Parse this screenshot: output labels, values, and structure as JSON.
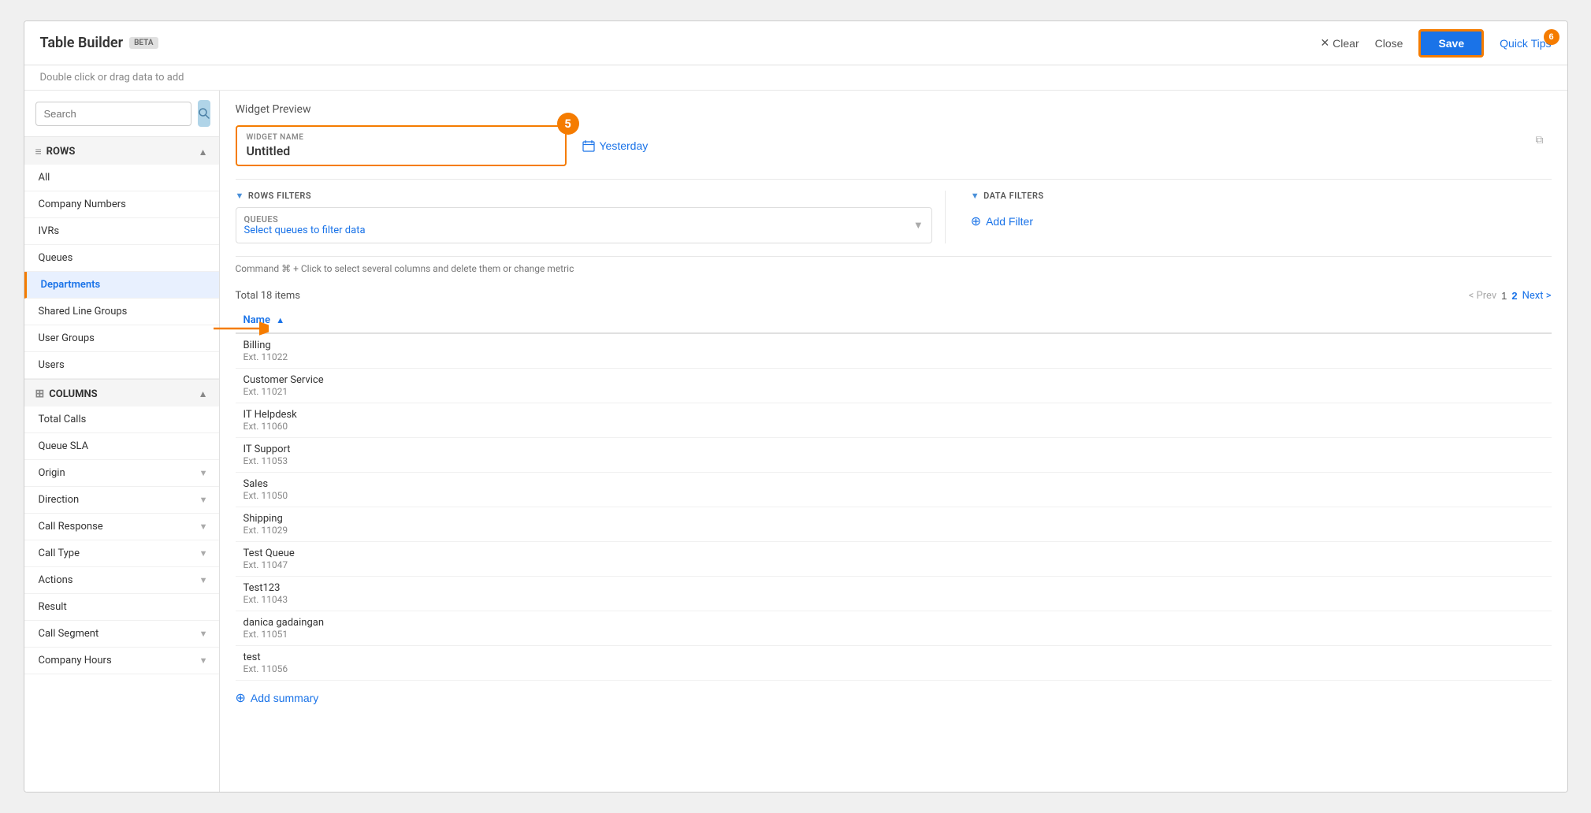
{
  "app": {
    "title": "Table Builder",
    "beta_label": "BETA"
  },
  "topbar": {
    "subtitle": "Double click or drag data to add",
    "widget_preview_label": "Widget Preview",
    "clear_label": "Clear",
    "close_label": "Close",
    "save_label": "Save",
    "quick_tips_label": "Quick Tips",
    "quick_tips_badge": "6"
  },
  "sidebar": {
    "search_placeholder": "Search",
    "rows_label": "ROWS",
    "columns_label": "COLUMNS",
    "rows_items": [
      {
        "label": "All",
        "active": false
      },
      {
        "label": "Company Numbers",
        "active": false
      },
      {
        "label": "IVRs",
        "active": false
      },
      {
        "label": "Queues",
        "active": false
      },
      {
        "label": "Departments",
        "active": true
      },
      {
        "label": "Shared Line Groups",
        "active": false
      },
      {
        "label": "User Groups",
        "active": false
      },
      {
        "label": "Users",
        "active": false
      }
    ],
    "columns_items": [
      {
        "label": "Total Calls",
        "has_arrow": false
      },
      {
        "label": "Queue SLA",
        "has_arrow": false
      },
      {
        "label": "Origin",
        "has_arrow": true
      },
      {
        "label": "Direction",
        "has_arrow": true
      },
      {
        "label": "Call Response",
        "has_arrow": true
      },
      {
        "label": "Call Type",
        "has_arrow": true
      },
      {
        "label": "Actions",
        "has_arrow": true
      },
      {
        "label": "Result",
        "has_arrow": false
      },
      {
        "label": "Call Segment",
        "has_arrow": true
      },
      {
        "label": "Company Hours",
        "has_arrow": true
      }
    ]
  },
  "widget": {
    "name_label": "WIDGET NAME",
    "name_value": "Untitled",
    "step_number": "5",
    "date_filter_label": "Yesterday"
  },
  "filters": {
    "rows_filters_label": "ROWS FILTERS",
    "data_filters_label": "DATA FILTERS",
    "queues_label": "QUEUES",
    "queues_placeholder": "Select queues to filter data",
    "add_filter_label": "Add Filter"
  },
  "command_hint": "Command ⌘ + Click  to select several columns and delete them or change metric",
  "table": {
    "total_label": "Total 18 items",
    "pagination": {
      "prev_label": "< Prev",
      "page1": "1",
      "page2": "2",
      "next_label": "Next >"
    },
    "column_name": "Name",
    "rows": [
      {
        "name": "Billing",
        "ext": "Ext. 11022"
      },
      {
        "name": "Customer Service",
        "ext": "Ext. 11021"
      },
      {
        "name": "IT Helpdesk",
        "ext": "Ext. 11060"
      },
      {
        "name": "IT Support",
        "ext": "Ext. 11053"
      },
      {
        "name": "Sales",
        "ext": "Ext. 11050"
      },
      {
        "name": "Shipping",
        "ext": "Ext. 11029"
      },
      {
        "name": "Test Queue",
        "ext": "Ext. 11047"
      },
      {
        "name": "Test123",
        "ext": "Ext. 11043"
      },
      {
        "name": "danica gadaingan",
        "ext": "Ext. 11051"
      },
      {
        "name": "test",
        "ext": "Ext. 11056"
      }
    ],
    "add_summary_label": "Add summary"
  },
  "colors": {
    "orange": "#f57c00",
    "blue": "#1a73e8",
    "light_blue_btn": "#b0d4e8"
  }
}
